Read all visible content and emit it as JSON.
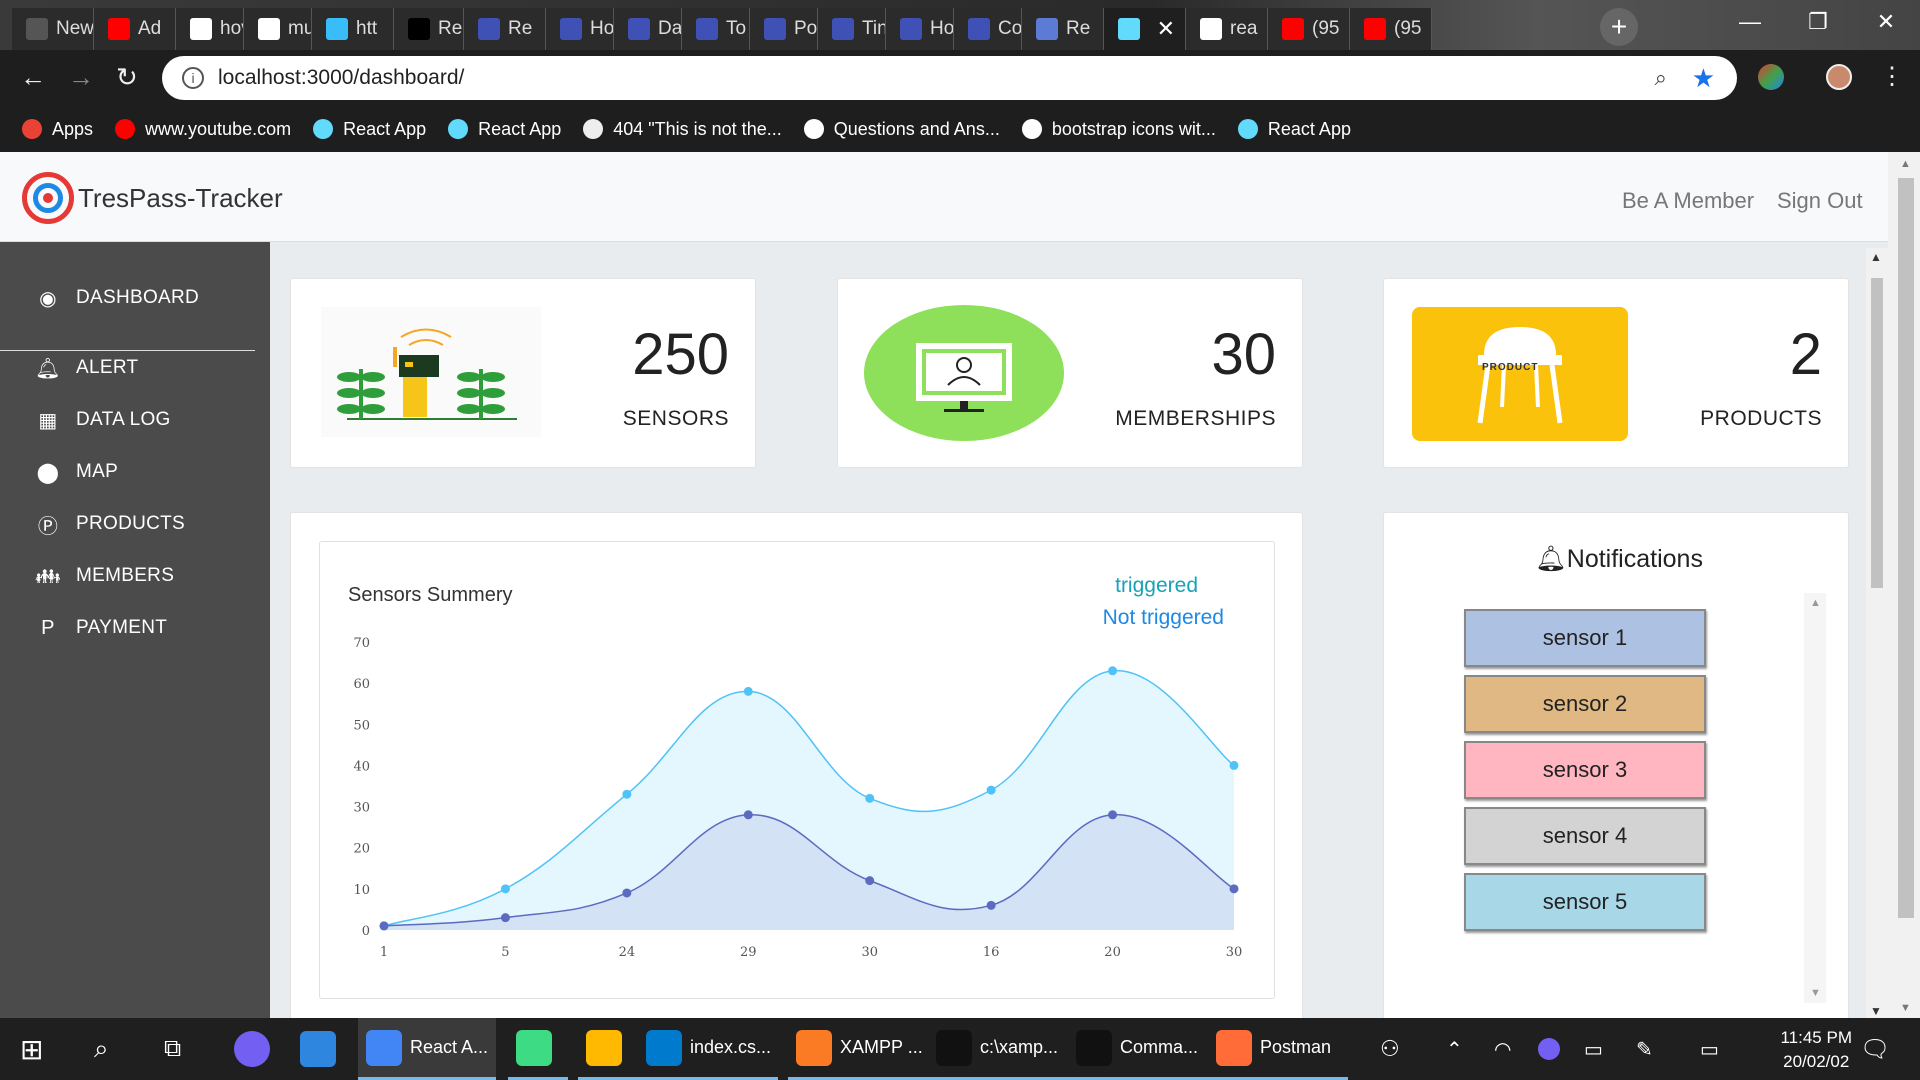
{
  "browser": {
    "tabs": [
      {
        "label": "New Ta",
        "color": "#555555"
      },
      {
        "label": "Ad",
        "color": "#ff0000"
      },
      {
        "label": "hov",
        "color": "#ffffff"
      },
      {
        "label": "mu",
        "color": "#ffffff"
      },
      {
        "label": "htt",
        "color": "#38bdf8"
      },
      {
        "label": "Re",
        "color": "#000000"
      },
      {
        "label": "Re",
        "color": "#3f51b5"
      },
      {
        "label": "Ho",
        "color": "#3f51b5"
      },
      {
        "label": "Da",
        "color": "#3f51b5"
      },
      {
        "label": "To",
        "color": "#3f51b5"
      },
      {
        "label": "Po",
        "color": "#3f51b5"
      },
      {
        "label": "Tin",
        "color": "#3f51b5"
      },
      {
        "label": "Ho",
        "color": "#3f51b5"
      },
      {
        "label": "Co",
        "color": "#3f51b5"
      },
      {
        "label": "Re",
        "color": "#5b7bd5"
      },
      {
        "label": "",
        "color": "#61dafb"
      },
      {
        "label": "rea",
        "color": "#ffffff"
      },
      {
        "label": "(95",
        "color": "#ff0000"
      },
      {
        "label": "(95",
        "color": "#ff0000"
      }
    ],
    "close_glyph": "✕",
    "new_tab_glyph": "+",
    "window_controls": [
      "—",
      "❐",
      "✕"
    ],
    "url": "localhost:3000/dashboard/",
    "bookmarks": [
      {
        "label": "Apps",
        "color": "#ea4335"
      },
      {
        "label": "www.youtube.com",
        "color": "#ff0000"
      },
      {
        "label": "React App",
        "color": "#61dafb"
      },
      {
        "label": "React App",
        "color": "#61dafb"
      },
      {
        "label": "404 \"This is not the...",
        "color": "#eeeeee"
      },
      {
        "label": "Questions and Ans...",
        "color": "#ffffff"
      },
      {
        "label": "bootstrap icons wit...",
        "color": "#ffffff"
      },
      {
        "label": "React App",
        "color": "#61dafb"
      }
    ]
  },
  "app": {
    "brand": "TresPass-Tracker",
    "nav": {
      "member": "Be A Member",
      "signout": "Sign Out"
    },
    "sidebar": [
      {
        "label": "DASHBOARD",
        "icon": "eye-icon",
        "glyph": "◉"
      },
      {
        "label": "ALERT",
        "icon": "bell-icon",
        "glyph": "🔔︎"
      },
      {
        "label": "DATA LOG",
        "icon": "table-icon",
        "glyph": "▦"
      },
      {
        "label": "MAP",
        "icon": "map-pin-icon",
        "glyph": "⬤"
      },
      {
        "label": "PRODUCTS",
        "icon": "product-p-icon",
        "glyph": "Ⓟ"
      },
      {
        "label": "MEMBERS",
        "icon": "members-icon",
        "glyph": "👪︎"
      },
      {
        "label": "PAYMENT",
        "icon": "paypal-icon",
        "glyph": "P"
      }
    ],
    "stats": [
      {
        "value": "250",
        "label": "SENSORS"
      },
      {
        "value": "30",
        "label": "MEMBERSHIPS"
      },
      {
        "value": "2",
        "label": "PRODUCTS",
        "image_text": "PRODUCT"
      }
    ],
    "notifications": {
      "title": "Notifications",
      "items": [
        {
          "label": "sensor 1",
          "color": "#adc2e3"
        },
        {
          "label": "sensor 2",
          "color": "#e0b884"
        },
        {
          "label": "sensor 3",
          "color": "#ffb6c1"
        },
        {
          "label": "sensor 4",
          "color": "#d3d3d3"
        },
        {
          "label": "sensor 5",
          "color": "#a8d8e8"
        }
      ]
    }
  },
  "chart_data": {
    "type": "area",
    "title": "Sensors Summery",
    "categories": [
      "1",
      "5",
      "24",
      "29",
      "30",
      "16",
      "20",
      "30"
    ],
    "ylim": [
      0,
      70
    ],
    "yticks": [
      0,
      10,
      20,
      30,
      40,
      50,
      60,
      70
    ],
    "legend_position": "top-right",
    "series": [
      {
        "name": "triggered",
        "color": "#4fc3f7",
        "values": [
          1,
          10,
          33,
          58,
          32,
          34,
          63,
          40
        ]
      },
      {
        "name": "Not triggered",
        "color": "#5c6bc0",
        "values": [
          1,
          3,
          9,
          28,
          12,
          6,
          28,
          10
        ]
      }
    ]
  },
  "taskbar": {
    "items": [
      {
        "label": "React A...",
        "color": "#4285f4"
      },
      {
        "label": "",
        "color": "#3ddc84"
      },
      {
        "label": "",
        "color": "#ffb900"
      },
      {
        "label": "index.cs...",
        "color": "#007acc"
      },
      {
        "label": "XAMPP ...",
        "color": "#fb7a24"
      },
      {
        "label": "c:\\xamp...",
        "color": "#111111"
      },
      {
        "label": "Comma...",
        "color": "#111111"
      },
      {
        "label": "Postman",
        "color": "#ff6c37"
      }
    ],
    "time": "11:45 PM",
    "date": "20/02/02"
  }
}
